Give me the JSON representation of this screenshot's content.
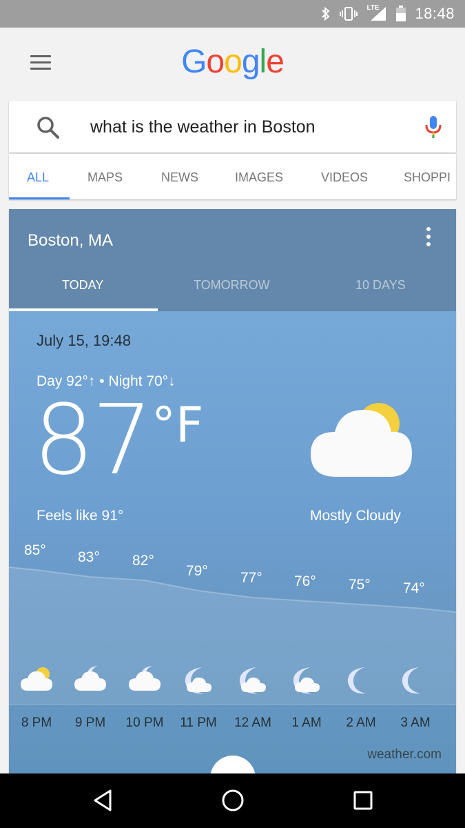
{
  "status_bar": {
    "time": "18:48",
    "network": "LTE",
    "icons": [
      "bluetooth-icon",
      "vibrate-icon",
      "signal-icon",
      "battery-icon"
    ]
  },
  "header": {
    "logo_letters": [
      "G",
      "o",
      "o",
      "g",
      "l",
      "e"
    ],
    "logo_colors": [
      "#4285f4",
      "#ea4335",
      "#fbbc05",
      "#4285f4",
      "#34a853",
      "#ea4335"
    ]
  },
  "search": {
    "query": "what is the weather in Boston"
  },
  "tabs": [
    {
      "label": "ALL",
      "active": true
    },
    {
      "label": "MAPS",
      "active": false
    },
    {
      "label": "NEWS",
      "active": false
    },
    {
      "label": "IMAGES",
      "active": false
    },
    {
      "label": "VIDEOS",
      "active": false
    },
    {
      "label": "SHOPPI",
      "active": false
    }
  ],
  "weather": {
    "location": "Boston, MA",
    "tabs": [
      {
        "label": "TODAY",
        "active": true
      },
      {
        "label": "TOMORROW",
        "active": false
      },
      {
        "label": "10 DAYS",
        "active": false
      }
    ],
    "datetime": "July 15, 19:48",
    "day_night": "Day 92°↑ • Night 70°↓",
    "temperature": "87",
    "unit": "°F",
    "feels_like": "Feels like 91°",
    "condition": "Mostly Cloudy",
    "condition_icon": "partly-cloudy-icon",
    "hourly": [
      {
        "time": "8 PM",
        "temp": "85°",
        "icon": "partly-cloudy-sun-icon"
      },
      {
        "time": "9 PM",
        "temp": "83°",
        "icon": "cloudy-moon-icon"
      },
      {
        "time": "10 PM",
        "temp": "82°",
        "icon": "cloudy-moon-icon"
      },
      {
        "time": "11 PM",
        "temp": "79°",
        "icon": "moon-cloud-icon"
      },
      {
        "time": "12 AM",
        "temp": "77°",
        "icon": "moon-cloud-icon"
      },
      {
        "time": "1 AM",
        "temp": "76°",
        "icon": "moon-cloud-icon"
      },
      {
        "time": "2 AM",
        "temp": "75°",
        "icon": "moon-icon"
      },
      {
        "time": "3 AM",
        "temp": "74°",
        "icon": "moon-icon"
      }
    ],
    "source": "weather.com"
  },
  "colors": {
    "accent": "#4285f4",
    "card_header": "#6488ab",
    "sky": "#76a8d8"
  }
}
